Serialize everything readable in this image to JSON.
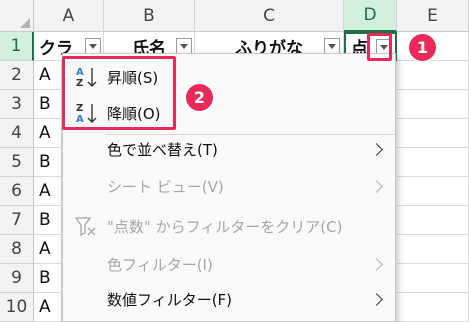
{
  "columns": [
    "A",
    "B",
    "C",
    "D",
    "E"
  ],
  "rows": [
    "1",
    "2",
    "3",
    "4",
    "5",
    "6",
    "7",
    "8",
    "9",
    "10"
  ],
  "header_row": {
    "a": "クラ",
    "b": "氏名",
    "c": "ふりがな",
    "d": "点"
  },
  "col_a_values": [
    "A",
    "B",
    "A",
    "B",
    "A",
    "B",
    "A",
    "B",
    "A"
  ],
  "badges": {
    "one": "1",
    "two": "2"
  },
  "menu": {
    "sort_asc": "昇順(S)",
    "sort_desc": "降順(O)",
    "sort_by_color": "色で並べ替え(T)",
    "sheet_view": "シート ビュー(V)",
    "clear_filter": "\"点数\" からフィルターをクリア(C)",
    "color_filter": "色フィルター(I)",
    "number_filter": "数値フィルター(F)"
  },
  "colors": {
    "accent_red": "#e8295a",
    "excel_green": "#1e7145",
    "selected_header": "#d3efdd"
  }
}
